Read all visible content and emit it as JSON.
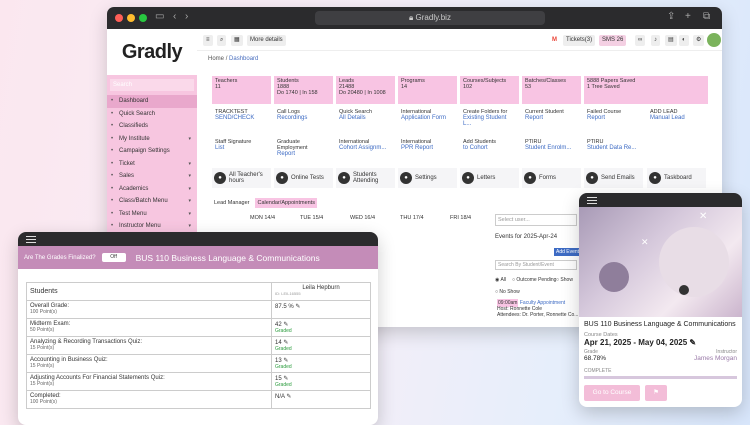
{
  "browser": {
    "url": "Gradly.biz"
  },
  "app": {
    "logo": "Gradly",
    "sidebar": {
      "search_placeholder": "Search",
      "items": [
        {
          "label": "Dashboard",
          "icon": "home-icon",
          "chev": ""
        },
        {
          "label": "Quick Search",
          "icon": "search-icon",
          "chev": ""
        },
        {
          "label": "Classifieds",
          "icon": "list-icon",
          "chev": ""
        },
        {
          "label": "My Institute",
          "icon": "building-icon",
          "chev": "▾"
        },
        {
          "label": "Campaign Settings",
          "icon": "gear-icon",
          "chev": ""
        },
        {
          "label": "Ticket",
          "icon": "ticket-icon",
          "chev": "▾"
        },
        {
          "label": "Sales",
          "icon": "sales-icon",
          "chev": "▾"
        },
        {
          "label": "Academics",
          "icon": "book-icon",
          "chev": "▾"
        },
        {
          "label": "Class/Batch Menu",
          "icon": "class-icon",
          "chev": "▾"
        },
        {
          "label": "Test Menu",
          "icon": "test-icon",
          "chev": "▾"
        },
        {
          "label": "Instructor Menu",
          "icon": "instructor-icon",
          "chev": "▾"
        }
      ]
    },
    "topbar": {
      "more_details": "More details",
      "tickets": "Tickets(3)",
      "sms": "SMS 26"
    },
    "breadcrumb": {
      "home": "Home",
      "sep": "/",
      "current": "Dashboard"
    },
    "stats": [
      {
        "title": "Teachers",
        "value": "11",
        "sub": ""
      },
      {
        "title": "Students",
        "value": "1888",
        "sub": "Do 1740 | In 158"
      },
      {
        "title": "Leads",
        "value": "21488",
        "sub": "Do 20480 | In 1008"
      },
      {
        "title": "Programs",
        "value": "14",
        "sub": ""
      },
      {
        "title": "Courses/Subjects",
        "value": "102",
        "sub": ""
      },
      {
        "title": "Batches/Classes",
        "value": "53",
        "sub": ""
      },
      {
        "title": "5888 Papers Saved",
        "value": "1 Tree Saved",
        "sub": ""
      }
    ],
    "links_row1": [
      {
        "title": "TRACKTEST",
        "link": "SEND/CHECK"
      },
      {
        "title": "Call Logs",
        "link": "Recordings"
      },
      {
        "title": "Quick Search",
        "link": "All Details"
      },
      {
        "title": "International",
        "link": "Application Form"
      },
      {
        "title": "Create Folders for",
        "link": "Existing Student L..."
      },
      {
        "title": "Current Student",
        "link": "Report"
      },
      {
        "title": "Failed Course",
        "link": "Report"
      },
      {
        "title": "ADD LEAD",
        "link": "Manual Lead"
      }
    ],
    "links_row2": [
      {
        "title": "Staff Signature",
        "link": "List"
      },
      {
        "title": "Graduate Employment",
        "link": "Report"
      },
      {
        "title": "International",
        "link": "Cohort Assignm..."
      },
      {
        "title": "International",
        "link": "PPR Report"
      },
      {
        "title": "Add Students",
        "link": "to Cohort"
      },
      {
        "title": "PTIRU",
        "link": "Student Enrolm..."
      },
      {
        "title": "PTIRU",
        "link": "Student Data Re..."
      }
    ],
    "quick_actions": [
      {
        "label": "All Teacher's hours",
        "icon": "clock-icon"
      },
      {
        "label": "Online Tests",
        "icon": "test-icon"
      },
      {
        "label": "Students Attending",
        "icon": "students-icon"
      },
      {
        "label": "Settings",
        "icon": "gear-icon"
      },
      {
        "label": "Letters",
        "icon": "letter-icon"
      },
      {
        "label": "Forms",
        "icon": "form-icon"
      },
      {
        "label": "Send Emails",
        "icon": "email-icon"
      },
      {
        "label": "Taskboard",
        "icon": "taskboard-icon"
      }
    ],
    "calendar": {
      "tabs": [
        "Lead Manager",
        "Calendar/Appointments"
      ],
      "days": [
        "MON 14/4",
        "TUE 15/4",
        "WED 16/4",
        "THU 17/4",
        "FRI 18/4"
      ],
      "select_user": "Select user...",
      "events_for": "Events for 2025-Apr-24",
      "add_event": "Add Event",
      "search_placeholder": "Search By Student/Event",
      "filters": [
        "All",
        "Outcome Pending",
        "Show",
        "No Show"
      ],
      "event_time": "09:00am",
      "event_title": "Faculty Appointment",
      "host": "Host: Ronnette Cole",
      "attendees": "Attendees: Dr. Porter, Ronnette Co..."
    }
  },
  "grades_panel": {
    "question": "Are The Grades Finalized?",
    "toggle": "Off",
    "course": "BUS 110 Business Language & Communications",
    "students_header": "Students",
    "student_name": "Leila Hepburn",
    "student_id": "ID: LEIL16555",
    "rows": [
      {
        "label": "Overall Grade:",
        "points": "100 Point(s)",
        "value": "87.5 %",
        "status": ""
      },
      {
        "label": "Midterm Exam:",
        "points": "50 Point(s)",
        "value": "42",
        "status": "Graded"
      },
      {
        "label": "Analyzing & Recording Transactions Quiz:",
        "points": "15 Point(s)",
        "value": "14",
        "status": "Graded"
      },
      {
        "label": "Accounting in Business Quiz:",
        "points": "15 Point(s)",
        "value": "13",
        "status": "Graded"
      },
      {
        "label": "Adjusting Accounts For Financial Statements Quiz:",
        "points": "15 Point(s)",
        "value": "15",
        "status": "Graded"
      },
      {
        "label": "Completed:",
        "points": "100 Point(s)",
        "value": "N/A",
        "status": ""
      }
    ]
  },
  "course_card": {
    "title": "BUS 110 Business Language & Communications",
    "dates_label": "Course Dates",
    "dates": "Apr 21, 2025 - May 04, 2025",
    "grade_label": "Grade",
    "grade": "68.78%",
    "instructor_label": "Instructor",
    "instructor": "James Morgan",
    "status": "COMPLETE",
    "button": "Go to Course"
  }
}
